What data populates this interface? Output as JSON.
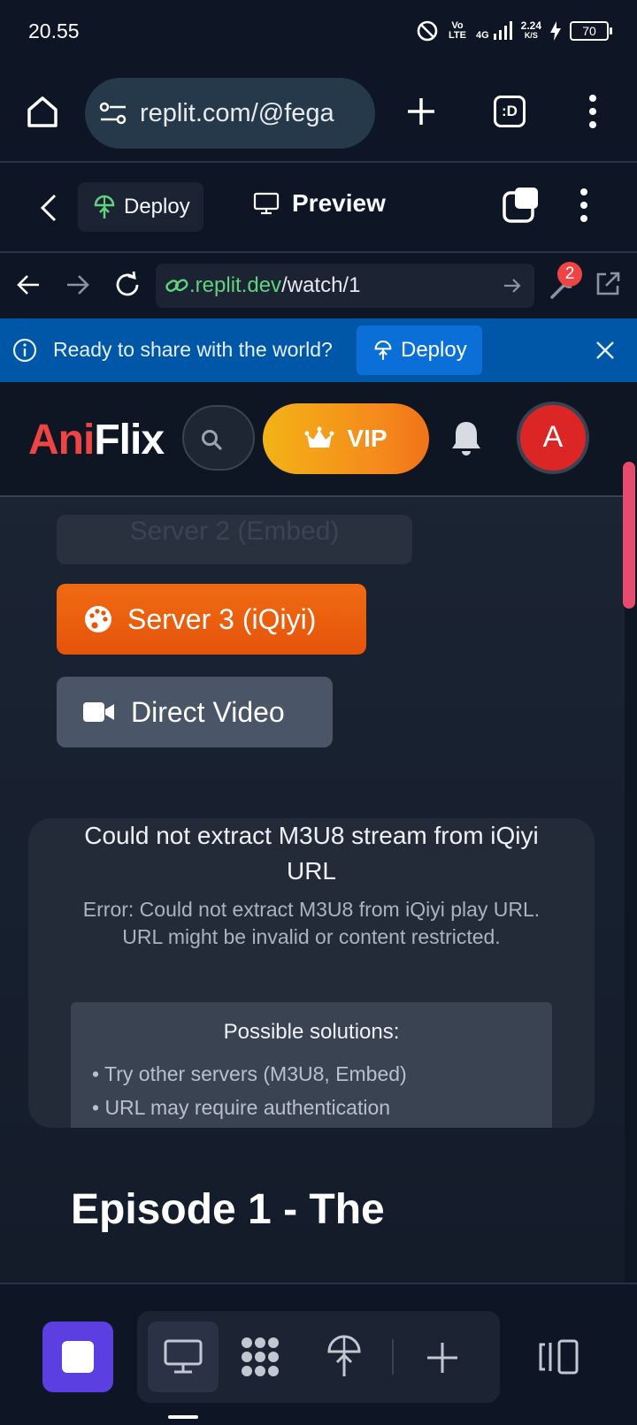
{
  "status_bar": {
    "time": "20.55",
    "volte": "Vo LTE",
    "network": "4G",
    "speed_value": "2.24",
    "speed_unit": "K/S",
    "battery": "70"
  },
  "browser": {
    "url": "replit.com/@fega",
    "tab_switcher_label": ":D"
  },
  "replit_header": {
    "deploy_label": "Deploy",
    "preview_label": "Preview"
  },
  "webview": {
    "url_host": ".replit.dev",
    "url_path": "/watch/1",
    "notification_count": "2"
  },
  "banner": {
    "message": "Ready to share with the world?",
    "deploy_label": "Deploy"
  },
  "site": {
    "logo_part1": "Ani",
    "logo_part2": "Flix",
    "vip_label": "VIP",
    "avatar_letter": "A",
    "server2_label": "Server 2 (Embed)",
    "server3_label": "Server 3 (iQiyi)",
    "direct_label": "Direct Video",
    "error": {
      "title": "Could not extract M3U8 stream from iQiyi URL",
      "message": "Error: Could not extract M3U8 from iQiyi play URL. URL might be invalid or content restricted.",
      "solutions_title": "Possible solutions:",
      "solutions": [
        "• Try other servers (M3U8, Embed)",
        "• URL may require authentication"
      ]
    },
    "episode_title": "Episode 1 - The"
  },
  "colors": {
    "accent_red": "#ef4444",
    "vip_gradient_start": "#f3b316",
    "vip_gradient_end": "#f07318",
    "server3_orange": "#e5540b",
    "banner_blue": "#0057a8",
    "replit_purple": "#5b3fe0"
  }
}
